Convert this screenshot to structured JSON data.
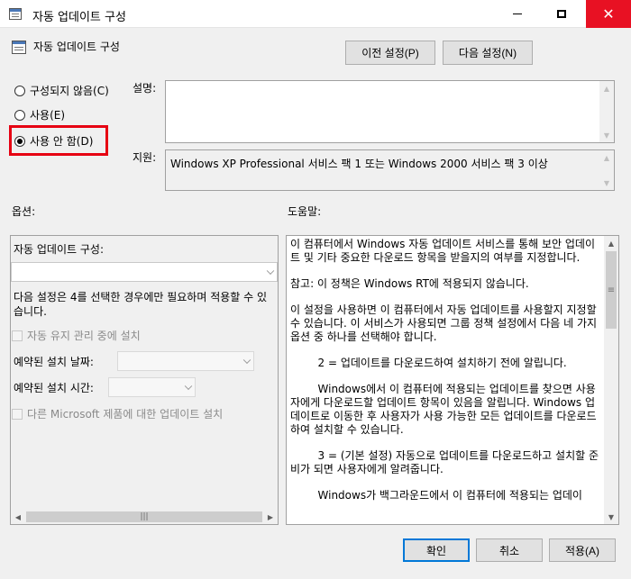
{
  "window": {
    "title": "자동 업데이트 구성",
    "minimize_glyph": "—",
    "close_glyph": "✕"
  },
  "header": {
    "title": "자동 업데이트 구성",
    "prev_button": "이전 설정(P)",
    "next_button": "다음 설정(N)"
  },
  "state": {
    "options": [
      {
        "label": "구성되지 않음(C)",
        "selected": false
      },
      {
        "label": "사용(E)",
        "selected": false
      },
      {
        "label": "사용 안 함(D)",
        "selected": true
      }
    ]
  },
  "description": {
    "label": "설명:",
    "value": ""
  },
  "support": {
    "label": "지원:",
    "value": "Windows XP Professional 서비스 팩 1 또는 Windows 2000 서비스 팩 3 이상"
  },
  "options_section": {
    "label": "옵션:",
    "configure_label": "자동 업데이트 구성:",
    "configure_value": "",
    "note": "다음 설정은 4를 선택한 경우에만 필요하며 적용할 수 있습니다.",
    "maintenance_checkbox": "자동 유지 관리 중에 설치",
    "install_day_label": "예약된 설치 날짜:",
    "install_time_label": "예약된 설치 시간:",
    "microsoft_checkbox": "다른 Microsoft 제품에 대한 업데이트 설치",
    "hscroll_thumb": "|||"
  },
  "help_section": {
    "label": "도움말:",
    "paragraphs": [
      "이 컴퓨터에서 Windows 자동 업데이트 서비스를 통해 보안 업데이트 및 기타 중요한 다운로드 항목을 받을지의 여부를 지정합니다.",
      "참고: 이 정책은 Windows RT에 적용되지 않습니다.",
      "이 설정을 사용하면 이 컴퓨터에서 자동 업데이트를 사용할지 지정할 수 있습니다. 이 서비스가 사용되면 그룹 정책 설정에서 다음 네 가지 옵션 중 하나를 선택해야 합니다.",
      "        2 = 업데이트를 다운로드하여 설치하기 전에 알립니다.",
      "        Windows에서 이 컴퓨터에 적용되는 업데이트를 찾으면 사용자에게 다운로드할 업데이트 항목이 있음을 알립니다. Windows 업데이트로 이동한 후 사용자가 사용 가능한 모든 업데이트를 다운로드하여 설치할 수 있습니다.",
      "        3 = (기본 설정) 자동으로 업데이트를 다운로드하고 설치할 준비가 되면 사용자에게 알려줍니다.",
      "        Windows가 백그라운드에서 이 컴퓨터에 적용되는 업데이"
    ],
    "scroll_thumb": "≡"
  },
  "footer": {
    "ok": "확인",
    "cancel": "취소",
    "apply": "적용(A)"
  }
}
